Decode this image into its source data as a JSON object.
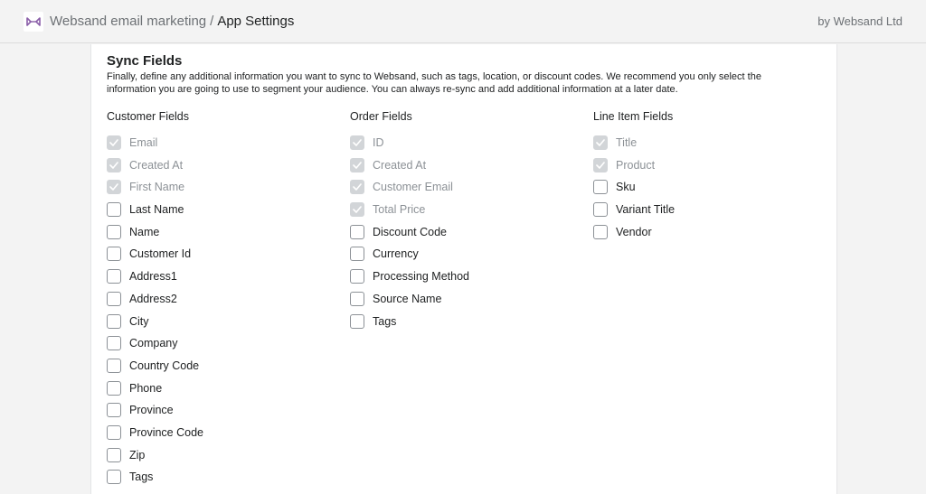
{
  "header": {
    "app_name": "Websand email marketing",
    "separator": "/",
    "page_title": "App Settings",
    "byline": "by Websand Ltd",
    "logo_icon": "websand-logo-icon",
    "logo_color": "#8a5ea8"
  },
  "section": {
    "title": "Sync Fields",
    "description": "Finally, define any additional information you want to sync to Websand, such as tags, location, or discount codes. We recommend you only select the information you are going to use to segment your audience. You can always re-sync and add additional information at a later date."
  },
  "columns": [
    {
      "heading": "Customer Fields",
      "fields": [
        {
          "label": "Email",
          "checked": true,
          "disabled": true
        },
        {
          "label": "Created At",
          "checked": true,
          "disabled": true
        },
        {
          "label": "First Name",
          "checked": true,
          "disabled": true
        },
        {
          "label": "Last Name",
          "checked": false,
          "disabled": false
        },
        {
          "label": "Name",
          "checked": false,
          "disabled": false
        },
        {
          "label": "Customer Id",
          "checked": false,
          "disabled": false
        },
        {
          "label": "Address1",
          "checked": false,
          "disabled": false
        },
        {
          "label": "Address2",
          "checked": false,
          "disabled": false
        },
        {
          "label": "City",
          "checked": false,
          "disabled": false
        },
        {
          "label": "Company",
          "checked": false,
          "disabled": false
        },
        {
          "label": "Country Code",
          "checked": false,
          "disabled": false
        },
        {
          "label": "Phone",
          "checked": false,
          "disabled": false
        },
        {
          "label": "Province",
          "checked": false,
          "disabled": false
        },
        {
          "label": "Province Code",
          "checked": false,
          "disabled": false
        },
        {
          "label": "Zip",
          "checked": false,
          "disabled": false
        },
        {
          "label": "Tags",
          "checked": false,
          "disabled": false
        }
      ]
    },
    {
      "heading": "Order Fields",
      "fields": [
        {
          "label": "ID",
          "checked": true,
          "disabled": true
        },
        {
          "label": "Created At",
          "checked": true,
          "disabled": true
        },
        {
          "label": "Customer Email",
          "checked": true,
          "disabled": true
        },
        {
          "label": "Total Price",
          "checked": true,
          "disabled": true
        },
        {
          "label": "Discount Code",
          "checked": false,
          "disabled": false
        },
        {
          "label": "Currency",
          "checked": false,
          "disabled": false
        },
        {
          "label": "Processing Method",
          "checked": false,
          "disabled": false
        },
        {
          "label": "Source Name",
          "checked": false,
          "disabled": false
        },
        {
          "label": "Tags",
          "checked": false,
          "disabled": false
        }
      ]
    },
    {
      "heading": "Line Item Fields",
      "fields": [
        {
          "label": "Title",
          "checked": true,
          "disabled": true
        },
        {
          "label": "Product",
          "checked": true,
          "disabled": true
        },
        {
          "label": "Sku",
          "checked": false,
          "disabled": false
        },
        {
          "label": "Variant Title",
          "checked": false,
          "disabled": false
        },
        {
          "label": "Vendor",
          "checked": false,
          "disabled": false
        }
      ]
    }
  ]
}
